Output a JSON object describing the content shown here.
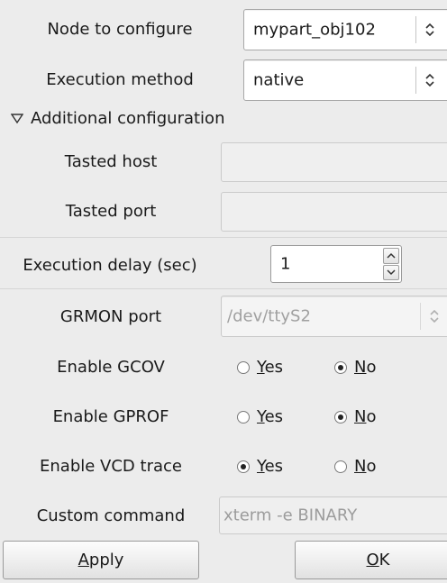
{
  "node": {
    "label": "Node to configure",
    "value": "mypart_obj102"
  },
  "exec_method": {
    "label": "Execution method",
    "value": "native"
  },
  "additional": {
    "label": "Additional configuration",
    "tasted_host_label": "Tasted host",
    "tasted_host_value": "",
    "tasted_port_label": "Tasted port",
    "tasted_port_value": ""
  },
  "exec_delay": {
    "label": "Execution delay (sec)",
    "value": "1"
  },
  "grmon": {
    "label": "GRMON port",
    "value": "/dev/ttyS2"
  },
  "gcov": {
    "label": "Enable GCOV",
    "yes_u": "Y",
    "yes_rest": "es",
    "no_u": "N",
    "no_rest": "o",
    "selected": "no"
  },
  "gprof": {
    "label": "Enable GPROF",
    "yes_u": "Y",
    "yes_rest": "es",
    "no_u": "N",
    "no_rest": "o",
    "selected": "no"
  },
  "vcd": {
    "label": "Enable VCD trace",
    "yes_u": "Y",
    "yes_rest": "es",
    "no_u": "N",
    "no_rest": "o",
    "selected": "yes"
  },
  "custom": {
    "label": "Custom command",
    "placeholder": "xterm -e BINARY"
  },
  "buttons": {
    "apply_u": "A",
    "apply_rest": "pply",
    "ok_u": "O",
    "ok_rest": "K"
  }
}
